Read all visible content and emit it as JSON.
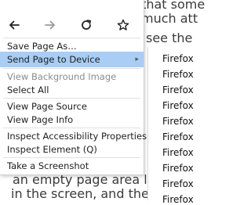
{
  "background_text": {
    "line1": "I have experienced that some",
    "line2": "much att",
    "line3": "see the",
    "line4": "an empty page area l",
    "line5": "in the screen, and the"
  },
  "toolbar": {
    "back_icon": "back-arrow-icon",
    "forward_icon": "forward-arrow-icon",
    "reload_icon": "reload-icon",
    "bookmark_icon": "star-icon"
  },
  "menu": {
    "save_page": "Save Page As…",
    "send_page": "Send Page to Device",
    "view_background": "View Background Image",
    "select_all": "Select All",
    "view_source": "View Page Source",
    "view_info": "View Page Info",
    "inspect_accessibility": "Inspect Accessibility Properties",
    "inspect_element": "Inspect Element (Q)",
    "take_screenshot": "Take a Screenshot"
  },
  "submenu": {
    "items": [
      "Firefox",
      "Firefox",
      "Firefox",
      "Firefox",
      "Firefox",
      "Firefox",
      "Firefox",
      "Firefox",
      "Firefox",
      "Firefox"
    ]
  },
  "colors": {
    "highlight": "#a9cdf5",
    "disabled_text": "#8c8c8c"
  }
}
